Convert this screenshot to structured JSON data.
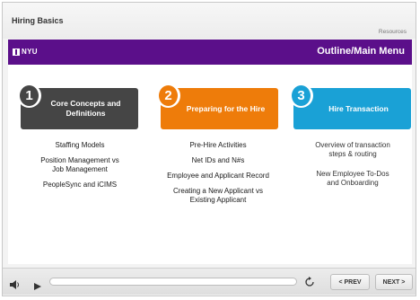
{
  "header": {
    "course_title": "Hiring Basics",
    "resources_label": "Resources"
  },
  "banner": {
    "logo_text": "NYU",
    "title": "Outline/Main Menu"
  },
  "modules": [
    {
      "number": "1",
      "title": "Core Concepts and Definitions",
      "color": "#454545",
      "topics": [
        "Staffing Models",
        "Position Management vs Job Management",
        "PeopleSync and iCIMS"
      ]
    },
    {
      "number": "2",
      "title": "Preparing for the Hire",
      "color": "#ee7c0a",
      "topics": [
        "Pre-Hire Activities",
        "Net IDs and N#s",
        "Employee and Applicant Record",
        "Creating a New Applicant vs Existing Applicant"
      ]
    },
    {
      "number": "3",
      "title": "Hire Transaction",
      "color": "#1aa1d6",
      "topics": [
        "Overview of transaction steps & routing",
        "New Employee To-Dos and Onboarding"
      ]
    }
  ],
  "controls": {
    "prev_label": "< PREV",
    "next_label": "NEXT >",
    "icons": [
      "volume-icon",
      "play-icon",
      "replay-icon"
    ]
  },
  "colors": {
    "brand_purple": "#5b0f8a"
  }
}
